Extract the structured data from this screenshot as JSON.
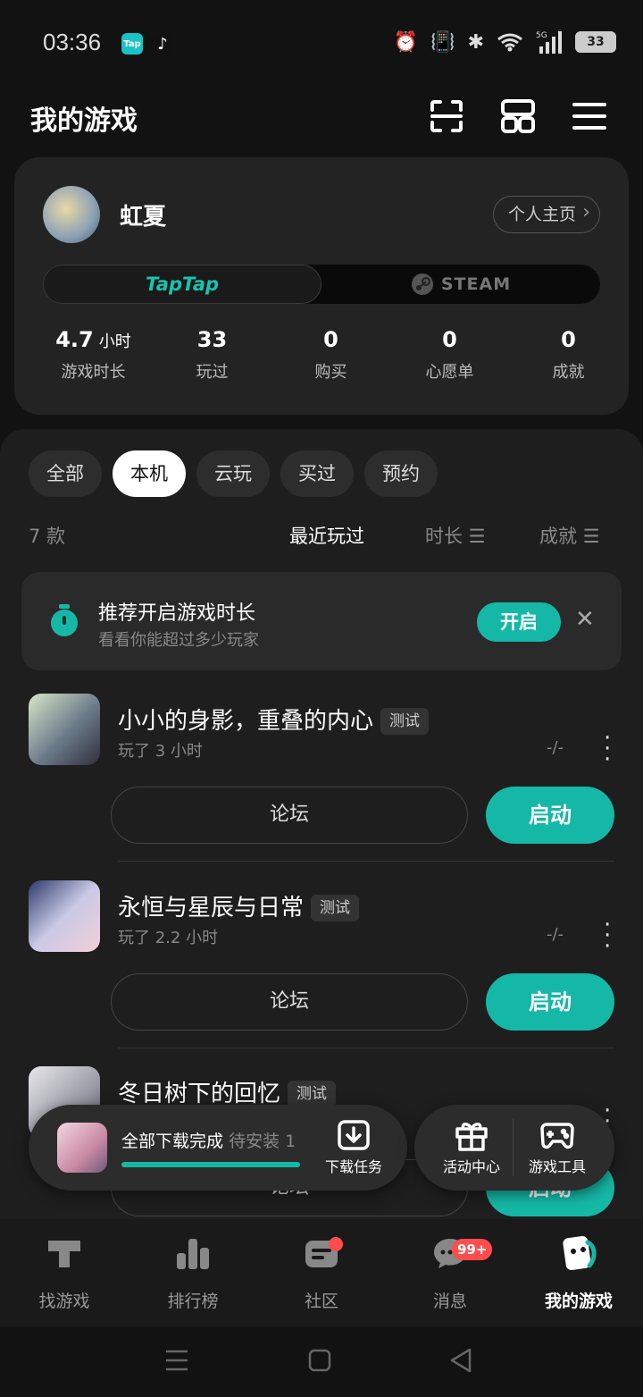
{
  "status_bar": {
    "time": "03:36",
    "battery": "33",
    "app_icons": [
      "taptap-icon",
      "tiktok-icon"
    ]
  },
  "header": {
    "title": "我的游戏"
  },
  "profile": {
    "username": "虹夏",
    "home_button": "个人主页",
    "platforms": {
      "taptap": "TapTap",
      "steam": "STEAM"
    },
    "stats": [
      {
        "value": "4.7",
        "unit": "小时",
        "label": "游戏时长"
      },
      {
        "value": "33",
        "unit": "",
        "label": "玩过"
      },
      {
        "value": "0",
        "unit": "",
        "label": "购买"
      },
      {
        "value": "0",
        "unit": "",
        "label": "心愿单"
      },
      {
        "value": "0",
        "unit": "",
        "label": "成就"
      }
    ]
  },
  "filters": {
    "chips": [
      "全部",
      "本机",
      "云玩",
      "买过",
      "预约"
    ],
    "active": "本机"
  },
  "sort": {
    "count": "7 款",
    "options": [
      "最近玩过",
      "时长",
      "成就"
    ]
  },
  "promo": {
    "title": "推荐开启游戏时长",
    "subtitle": "看看你能超过多少玩家",
    "button": "开启"
  },
  "games": [
    {
      "name": "小小的身影，重叠的内心",
      "tag": "测试",
      "played": "玩了 3 小时",
      "rating": "-/-",
      "forum": "论坛",
      "launch": "启动"
    },
    {
      "name": "永恒与星辰与日常",
      "tag": "测试",
      "played": "玩了 2.2 小时",
      "rating": "-/-",
      "forum": "论坛",
      "launch": "启动"
    },
    {
      "name": "冬日树下的回忆",
      "tag": "测试",
      "played": "",
      "rating": "",
      "forum": "论坛",
      "launch": "启动"
    }
  ],
  "download_bar": {
    "text": "全部下载完成",
    "pending": "待安装 1",
    "task_label": "下载任务"
  },
  "tools_bar": {
    "activity": "活动中心",
    "tools": "游戏工具"
  },
  "bottom_nav": {
    "items": [
      {
        "label": "找游戏"
      },
      {
        "label": "排行榜"
      },
      {
        "label": "社区"
      },
      {
        "label": "消息",
        "badge": "99+"
      },
      {
        "label": "我的游戏"
      }
    ],
    "active": "我的游戏"
  },
  "colors": {
    "accent": "#15b8a6",
    "background": "#121212",
    "card": "#232323",
    "badge": "#ff4d4d"
  }
}
